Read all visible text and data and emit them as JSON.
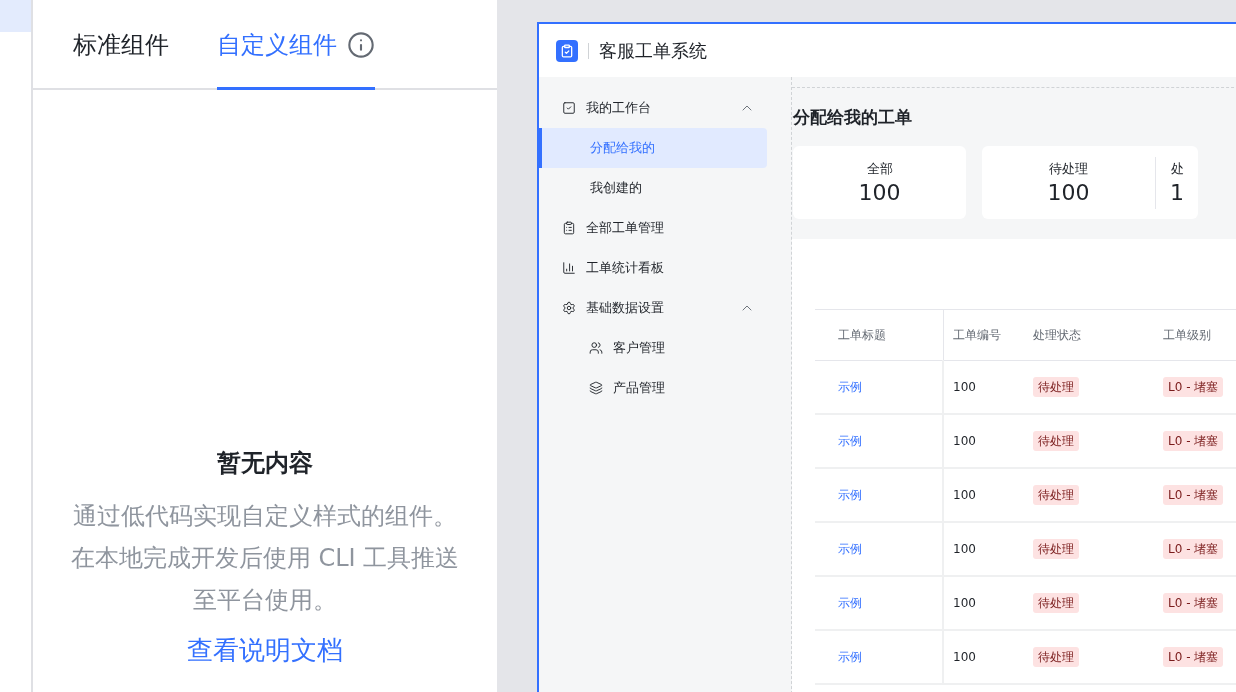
{
  "panel_tabs": [
    {
      "label": "标准组件",
      "selected": false,
      "info": false
    },
    {
      "label": "自定义组件",
      "selected": true,
      "info": true
    }
  ],
  "empty_state": {
    "title": "暂无内容",
    "description": "通过低代码实现自定义样式的组件。在本地完成开发后使用 CLI 工具推送至平台使用。",
    "link": "查看说明文档"
  },
  "preview": {
    "app_title": "客服工单系统",
    "nav": [
      {
        "label": "我的工作台",
        "expanded": true,
        "selected": false,
        "children": [
          {
            "label": "分配给我的",
            "selected": true
          },
          {
            "label": "我创建的",
            "selected": false
          }
        ]
      },
      {
        "label": "全部工单管理",
        "selected": false
      },
      {
        "label": "工单统计看板",
        "selected": false
      },
      {
        "label": "基础数据设置",
        "expanded": true,
        "selected": false,
        "children": [
          {
            "label": "客户管理",
            "selected": false
          },
          {
            "label": "产品管理",
            "selected": false
          }
        ]
      }
    ],
    "page_title": "分配给我的工单",
    "stat_cards": [
      {
        "items": [
          {
            "label": "全部",
            "value": "100"
          }
        ]
      },
      {
        "items": [
          {
            "label": "待处理",
            "value": "100"
          },
          {
            "label": "处",
            "value": "1"
          }
        ]
      }
    ],
    "table": {
      "columns": [
        "工单标题",
        "工单编号",
        "处理状态",
        "工单级别"
      ],
      "rows": [
        {
          "title": "示例",
          "number": "100",
          "status": "待处理",
          "level": "L0 - 堵塞"
        },
        {
          "title": "示例",
          "number": "100",
          "status": "待处理",
          "level": "L0 - 堵塞"
        },
        {
          "title": "示例",
          "number": "100",
          "status": "待处理",
          "level": "L0 - 堵塞"
        },
        {
          "title": "示例",
          "number": "100",
          "status": "待处理",
          "level": "L0 - 堵塞"
        },
        {
          "title": "示例",
          "number": "100",
          "status": "待处理",
          "level": "L0 - 堵塞"
        },
        {
          "title": "示例",
          "number": "100",
          "status": "待处理",
          "level": "L0 - 堵塞"
        }
      ]
    }
  }
}
